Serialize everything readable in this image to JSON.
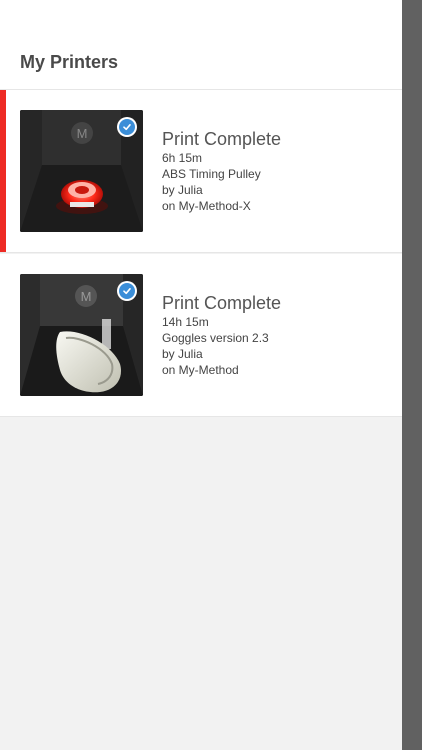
{
  "page": {
    "title": "My Printers"
  },
  "printers": [
    {
      "status": "Print Complete",
      "duration": "6h 15m",
      "job_name": "ABS Timing Pulley",
      "user": "by Julia",
      "printer": "on My-Method-X",
      "selected": true,
      "thumbnail": "printed-pulley-thumbnail"
    },
    {
      "status": "Print Complete",
      "duration": "14h 15m",
      "job_name": "Goggles version 2.3",
      "user": "by Julia",
      "printer": "on My-Method",
      "selected": false,
      "thumbnail": "printed-goggles-thumbnail"
    }
  ],
  "colors": {
    "accent": "#ee2a24",
    "check": "#3b8ed8",
    "background": "#f2f2f2",
    "scroll_rail": "#616161"
  }
}
